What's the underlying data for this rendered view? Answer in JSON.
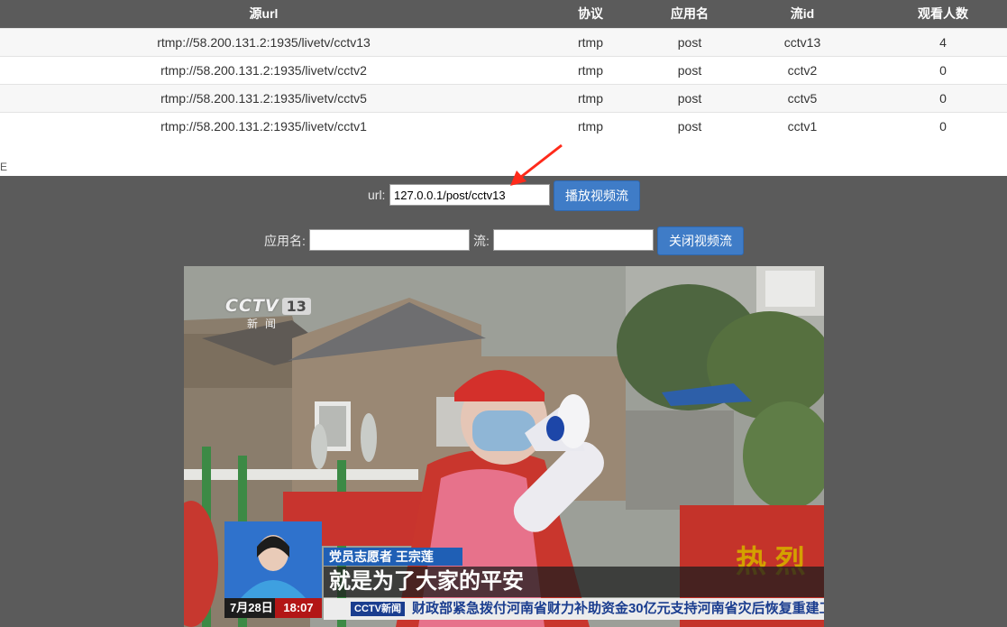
{
  "table": {
    "headers": [
      "源url",
      "协议",
      "应用名",
      "流id",
      "观看人数"
    ],
    "rows": [
      [
        "rtmp://58.200.131.2:1935/livetv/cctv13",
        "rtmp",
        "post",
        "cctv13",
        "4"
      ],
      [
        "rtmp://58.200.131.2:1935/livetv/cctv2",
        "rtmp",
        "post",
        "cctv2",
        "0"
      ],
      [
        "rtmp://58.200.131.2:1935/livetv/cctv5",
        "rtmp",
        "post",
        "cctv5",
        "0"
      ],
      [
        "rtmp://58.200.131.2:1935/livetv/cctv1",
        "rtmp",
        "post",
        "cctv1",
        "0"
      ]
    ]
  },
  "stray_char": "E",
  "player": {
    "url_label": "url:",
    "url_value": "127.0.0.1/post/cctv13",
    "play_button": "播放视频流",
    "app_label": "应用名:",
    "app_value": "",
    "stream_label": "流:",
    "stream_value": "",
    "close_button": "关闭视频流"
  },
  "video": {
    "channel_logo": "CCTV",
    "channel_number": "13",
    "channel_sub": "新闻",
    "name_tag": "党员志愿者 王宗莲",
    "caption": "就是为了大家的平安",
    "date": "7月28日",
    "time": "18:07",
    "ticker_logo": "CCTV新闻",
    "ticker": "财政部紧急拨付河南省财力补助资金30亿元支持河南省灾后恢复重建工",
    "banner_text": "热 烈"
  },
  "colors": {
    "header_bg": "#5b5b5b",
    "button_bg": "#3f7cc7",
    "annotation_arrow": "#ff2a1a"
  },
  "icons": [
    "annotation-arrow-icon"
  ]
}
